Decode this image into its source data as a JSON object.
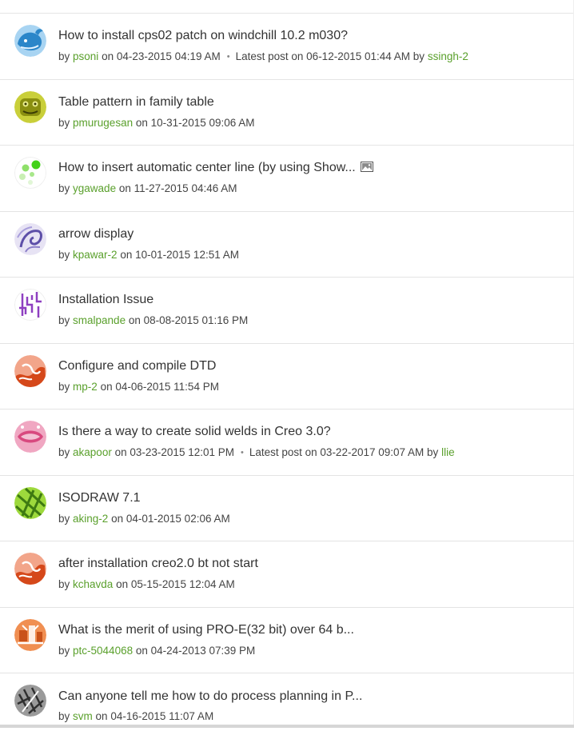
{
  "threads": [
    {
      "title": "How to install cps02 patch on windchill 10.2 m030?",
      "by": "by",
      "author": "psoni",
      "on": "on",
      "date": "04-23-2015 04:19 AM",
      "sep": "•",
      "latest_label": "Latest post on",
      "latest_date": "06-12-2015 01:44 AM",
      "latest_by": "by",
      "latest_author": "ssingh-2",
      "avatar_icon": "whale-avatar-icon",
      "avatar_colors": [
        "#2b86c9",
        "#a8d4f2"
      ]
    },
    {
      "title": "Table pattern in family table",
      "by": "by",
      "author": "pmurugesan",
      "on": "on",
      "date": "10-31-2015 09:06 AM",
      "avatar_icon": "frog-face-avatar-icon",
      "avatar_colors": [
        "#8a8f10",
        "#c9cf3a"
      ]
    },
    {
      "title": "How to insert automatic center line (by using Show...",
      "has_image_icon": true,
      "image_icon": "image-icon",
      "by": "by",
      "author": "ygawade",
      "on": "on",
      "date": "11-27-2015 04:46 AM",
      "avatar_icon": "green-dots-avatar-icon",
      "avatar_colors": [
        "#ffffff",
        "#44d11a"
      ]
    },
    {
      "title": "arrow display",
      "by": "by",
      "author": "kpawar-2",
      "on": "on",
      "date": "10-01-2015 12:51 AM",
      "avatar_icon": "purple-swirl-avatar-icon",
      "avatar_colors": [
        "#e7e3f4",
        "#5d4fa8"
      ]
    },
    {
      "title": "Installation Issue",
      "by": "by",
      "author": "smalpande",
      "on": "on",
      "date": "08-08-2015 01:16 PM",
      "avatar_icon": "purple-maze-avatar-icon",
      "avatar_colors": [
        "#ffffff",
        "#8e3fc0"
      ]
    },
    {
      "title": "Configure and compile DTD",
      "by": "by",
      "author": "mp-2",
      "on": "on",
      "date": "04-06-2015 11:54 PM",
      "avatar_icon": "orange-swirl-avatar-icon",
      "avatar_colors": [
        "#f2a58a",
        "#d5481a"
      ]
    },
    {
      "title": "Is there a way to create solid welds in Creo 3.0?",
      "by": "by",
      "author": "akapoor",
      "on": "on",
      "date": "03-23-2015 12:01 PM",
      "sep": "•",
      "latest_label": "Latest post on",
      "latest_date": "03-22-2017 09:07 AM",
      "latest_by": "by",
      "latest_author": "llie",
      "avatar_icon": "pink-mouth-avatar-icon",
      "avatar_colors": [
        "#f0a7c2",
        "#d8497f"
      ]
    },
    {
      "title": "ISODRAW 7.1",
      "by": "by",
      "author": "aking-2",
      "on": "on",
      "date": "04-01-2015 02:06 AM",
      "avatar_icon": "green-lines-avatar-icon",
      "avatar_colors": [
        "#9dd93c",
        "#3e7a12"
      ]
    },
    {
      "title": "after installation creo2.0 bt not start",
      "by": "by",
      "author": "kchavda",
      "on": "on",
      "date": "05-15-2015 12:04 AM",
      "avatar_icon": "orange-swirl-avatar-icon",
      "avatar_colors": [
        "#f2a58a",
        "#d5481a"
      ]
    },
    {
      "title": "What is the merit of using PRO-E(32 bit) over 64 b...",
      "by": "by",
      "author": "ptc-5044068",
      "on": "on",
      "date": "04-24-2013 07:39 PM",
      "avatar_icon": "orange-blocks-avatar-icon",
      "avatar_colors": [
        "#f08f52",
        "#c9521a"
      ]
    },
    {
      "title": "Can anyone tell me how to do process planning in P...",
      "by": "by",
      "author": "svm",
      "on": "on",
      "date": "04-16-2015 11:07 AM",
      "avatar_icon": "grey-sketch-avatar-icon",
      "avatar_colors": [
        "#9a9a9a",
        "#2f2f2f"
      ]
    }
  ]
}
